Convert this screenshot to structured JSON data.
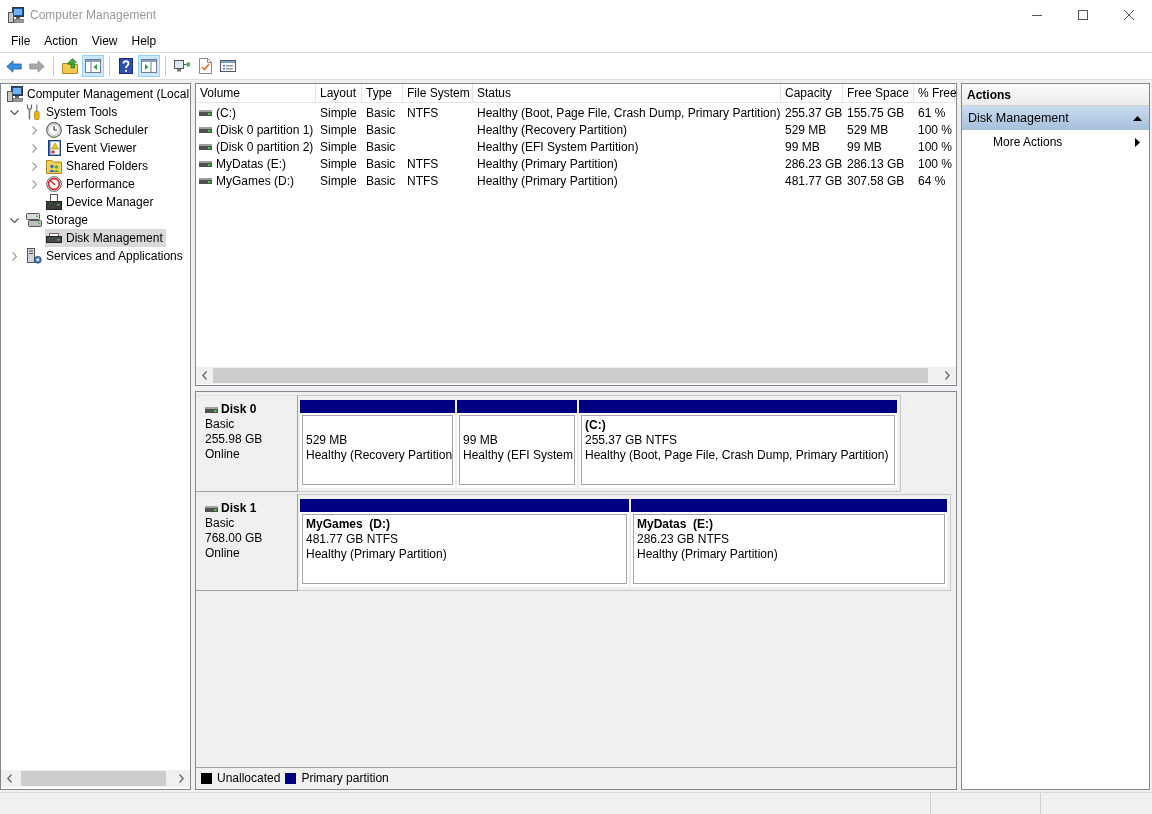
{
  "window": {
    "title": "Computer Management"
  },
  "menu": [
    {
      "label": "File"
    },
    {
      "label": "Action"
    },
    {
      "label": "View"
    },
    {
      "label": "Help"
    }
  ],
  "toolbar": {
    "groups": [
      [
        {
          "kind": "back",
          "disabled": false
        },
        {
          "kind": "forward",
          "disabled": true
        }
      ],
      [
        {
          "kind": "up",
          "disabled": false
        },
        {
          "kind": "tree",
          "disabled": false,
          "pressed": true
        }
      ],
      [
        {
          "kind": "help",
          "disabled": false
        },
        {
          "kind": "panel",
          "disabled": false,
          "pressed": true
        }
      ],
      [
        {
          "kind": "connect",
          "disabled": false
        },
        {
          "kind": "check",
          "disabled": false
        },
        {
          "kind": "properties",
          "disabled": false
        }
      ]
    ]
  },
  "tree": [
    {
      "label": "Computer Management (Local",
      "kind": "computer",
      "expandable": false,
      "selected": false,
      "children": [
        {
          "label": "System Tools",
          "kind": "tools",
          "expandable": true,
          "expanded": true,
          "selected": false,
          "children": [
            {
              "label": "Task Scheduler",
              "kind": "clock",
              "expandable": true,
              "expanded": false,
              "selected": false
            },
            {
              "label": "Event Viewer",
              "kind": "eventlog",
              "expandable": true,
              "expanded": false,
              "selected": false
            },
            {
              "label": "Shared Folders",
              "kind": "share",
              "expandable": true,
              "expanded": false,
              "selected": false
            },
            {
              "label": "Performance",
              "kind": "performance",
              "expandable": true,
              "expanded": false,
              "selected": false
            },
            {
              "label": "Device Manager",
              "kind": "devices",
              "expandable": false,
              "selected": false
            }
          ]
        },
        {
          "label": "Storage",
          "kind": "storage",
          "expandable": true,
          "expanded": true,
          "selected": false,
          "children": [
            {
              "label": "Disk Management",
              "kind": "disk",
              "expandable": false,
              "selected": true
            }
          ]
        },
        {
          "label": "Services and Applications",
          "kind": "services",
          "expandable": true,
          "expanded": false,
          "selected": false
        }
      ]
    }
  ],
  "table": {
    "columns": [
      "Volume",
      "Layout",
      "Type",
      "File System",
      "Status",
      "Capacity",
      "Free Space",
      "% Free"
    ],
    "rows": [
      {
        "volume": "(C:)",
        "layout": "Simple",
        "type": "Basic",
        "file_system": "NTFS",
        "status": "Healthy (Boot, Page File, Crash Dump, Primary Partition)",
        "capacity": "255.37 GB",
        "free_space": "155.75 GB",
        "percent_free": "61 %",
        "selected": false
      },
      {
        "volume": "(Disk 0 partition 1)",
        "layout": "Simple",
        "type": "Basic",
        "status": "Healthy (Recovery Partition)",
        "capacity": "529 MB",
        "free_space": "529 MB",
        "percent_free": "100 %",
        "selected": false
      },
      {
        "volume": "(Disk 0 partition 2)",
        "layout": "Simple",
        "type": "Basic",
        "status": "Healthy (EFI System Partition)",
        "capacity": "99 MB",
        "free_space": "99 MB",
        "percent_free": "100 %",
        "selected": false
      },
      {
        "volume": "MyDatas (E:)",
        "layout": "Simple",
        "type": "Basic",
        "file_system": "NTFS",
        "status": "Healthy (Primary Partition)",
        "capacity": "286.23 GB",
        "free_space": "286.13 GB",
        "percent_free": "100 %",
        "selected": false
      },
      {
        "volume": "MyGames (D:)",
        "layout": "Simple",
        "type": "Basic",
        "file_system": "NTFS",
        "status": "Healthy (Primary Partition)",
        "capacity": "481.77 GB",
        "free_space": "307.58 GB",
        "percent_free": "64 %",
        "selected": false
      }
    ]
  },
  "disks": [
    {
      "name": "Disk 0",
      "type": "Basic",
      "size": "255.98 GB",
      "status": "Online",
      "partitions": [
        {
          "size": "529 MB",
          "status": "Healthy (Recovery Partition",
          "color": "#000080",
          "selected": false
        },
        {
          "size": "99 MB",
          "status": "Healthy (EFI System",
          "color": "#000080",
          "selected": false
        },
        {
          "name": "(C:)",
          "size": "255.37 GB NTFS",
          "status": "Healthy (Boot, Page File, Crash Dump, Primary Partition)",
          "color": "#000080",
          "selected": false
        }
      ]
    },
    {
      "name": "Disk 1",
      "type": "Basic",
      "size": "768.00 GB",
      "status": "Online",
      "partitions": [
        {
          "name": "MyGames  (D:)",
          "size": "481.77 GB NTFS",
          "status": "Healthy (Primary Partition)",
          "color": "#000080",
          "selected": false
        },
        {
          "name": "MyDatas  (E:)",
          "size": "286.23 GB NTFS",
          "status": "Healthy (Primary Partition)",
          "color": "#000080",
          "selected": false
        }
      ]
    }
  ],
  "legend": [
    {
      "label": "Unallocated",
      "color": "#000000"
    },
    {
      "label": "Primary partition",
      "color": "#000080"
    }
  ],
  "actions": {
    "title": "Actions",
    "sections": [
      {
        "label": "Disk Management",
        "expanded": true,
        "items": [
          {
            "label": "More Actions",
            "submenu": true
          }
        ]
      }
    ]
  }
}
